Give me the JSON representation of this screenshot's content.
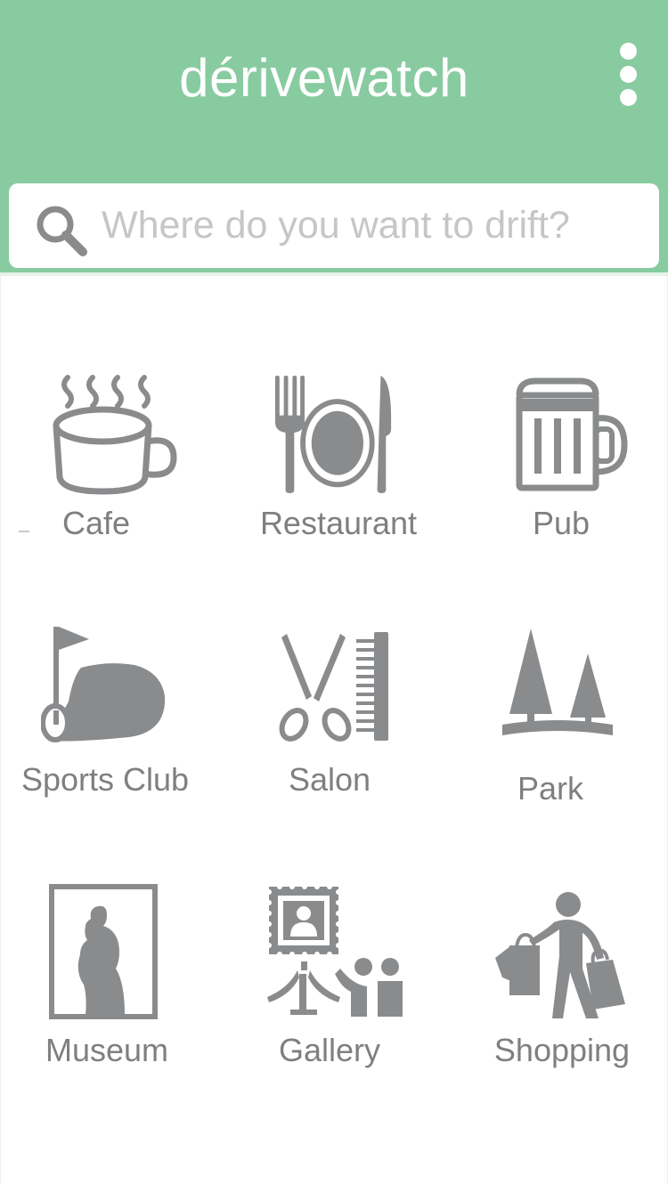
{
  "app": {
    "title": "dérivewatch",
    "brand_color": "#88cba0"
  },
  "header": {
    "menu_icon": "more-vertical-icon"
  },
  "search": {
    "icon": "search-icon",
    "placeholder": "Where do you want to drift?",
    "value": ""
  },
  "categories": [
    {
      "label": "Cafe",
      "icon": "coffee-cup-icon"
    },
    {
      "label": "Restaurant",
      "icon": "plate-fork-knife-icon"
    },
    {
      "label": "Pub",
      "icon": "beer-mug-icon"
    },
    {
      "label": "Sports Club",
      "icon": "golf-flag-icon"
    },
    {
      "label": "Salon",
      "icon": "scissors-comb-icon"
    },
    {
      "label": "Park",
      "icon": "trees-icon"
    },
    {
      "label": "Museum",
      "icon": "statue-frame-icon"
    },
    {
      "label": "Gallery",
      "icon": "easel-visitors-icon"
    },
    {
      "label": "Shopping",
      "icon": "shopper-bags-icon"
    }
  ],
  "icon_color": "#8a8b8d"
}
